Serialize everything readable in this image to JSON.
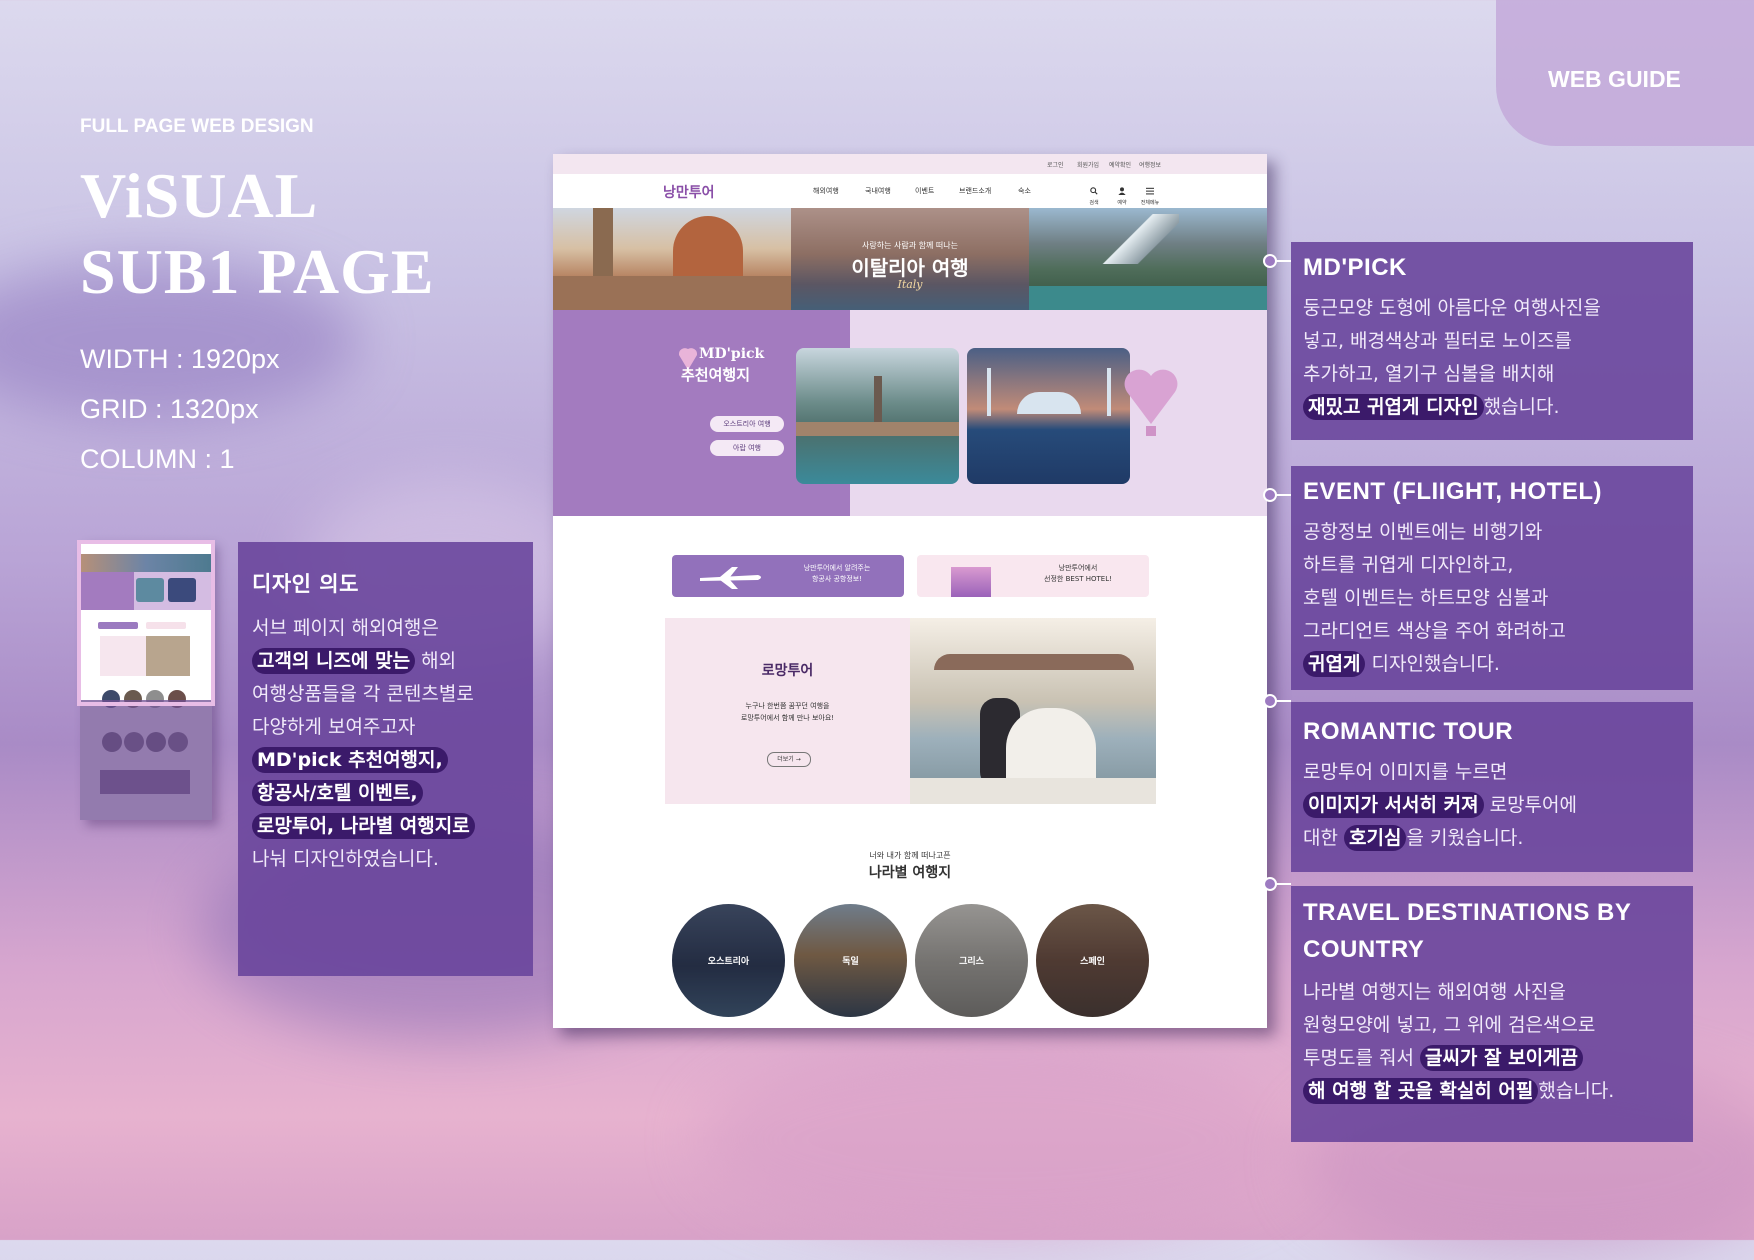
{
  "header": {
    "kicker": "FULL PAGE WEB DESIGN",
    "title_line1": "ViSUAL",
    "title_line2": "SUB1 PAGE",
    "width": "WIDTH : 1920px",
    "grid": "GRID : 1320px",
    "column": "COLUMN : 1",
    "guide_tab": "WEB GUIDE"
  },
  "intent_panel": {
    "title": "디자인 의도",
    "t1": "서브 페이지 해외여행은",
    "h1": "고객의 니즈에 맞는",
    "t2": " 해외",
    "t3": "여행상품들을 각 콘텐츠별로",
    "t4": "다양하게 보여주고자",
    "h2": "MD'pick 추천여행지,",
    "h3": "항공사/호텔 이벤트,",
    "h4": "로망투어, 나라별 여행지로",
    "t5": "나눠 디자인하였습니다."
  },
  "panels": {
    "mdpick": {
      "title": "MD'PICK",
      "l1": "둥근모양 도형에 아름다운 여행사진을",
      "l2": "넣고, 배경색상과 필터로 노이즈를",
      "l3": "추가하고, 열기구 심볼을 배치해",
      "hl": "재밌고 귀엽게 디자인",
      "l4": "했습니다."
    },
    "event": {
      "title": "EVENT (FLIIGHT, HOTEL)",
      "l1": "공항정보 이벤트에는 비행기와",
      "l2": "하트를 귀엽게 디자인하고,",
      "l3": "호텔 이벤트는 하트모양 심볼과",
      "l4": "그라디언트 색상을 주어 화려하고",
      "hl": "귀엽게",
      "l5": " 디자인했습니다."
    },
    "romantic": {
      "title": "ROMANTIC TOUR",
      "l1": "로망투어 이미지를 누르면",
      "hl1": "이미지가 서서히 커져",
      "l2": " 로망투어에",
      "l3": "대한 ",
      "hl2": "호기심",
      "l4": "을 키웠습니다."
    },
    "countries": {
      "title1": "TRAVEL DESTINATIONS BY",
      "title2": "COUNTRY",
      "l1": "나라별 여행지는 해외여행 사진을",
      "l2": "원형모양에 넣고, 그 위에 검은색으로",
      "l3": "투명도를 줘서 ",
      "hl1": "글씨가 잘 보이게끔",
      "hl2": "해 여행 할 곳을 확실히 어필",
      "l4": "했습니다."
    }
  },
  "mockup": {
    "util_links": [
      "로그인",
      "회원가입",
      "예약확인",
      "여행정보"
    ],
    "logo": "낭만투어",
    "menu": [
      "해외여행",
      "국내여행",
      "이벤트",
      "브랜드소개",
      "숙소"
    ],
    "icon_labels": [
      "검색",
      "예약",
      "전체메뉴"
    ],
    "hero_sub": "사랑하는 사람과 함께 떠나는",
    "hero_title": "이탈리아 여행",
    "hero_script": "Italy",
    "md_title": "MD'pick",
    "md_sub": "추천여행지",
    "md_btn1": "오스트리아 여행",
    "md_btn2": "아랍 여행",
    "event1_l1": "낭만투어에서 알려주는",
    "event1_l2": "항공사 공항정보!",
    "event2_l1": "낭만투어에서",
    "event2_l2": "선정한 BEST HOTEL!",
    "romantic_title": "로망투어",
    "romantic_l1": "누구나 한번쯤 꿈꾸던 여행을",
    "romantic_l2": "로망투어에서 함께 만나 보아요!",
    "romantic_btn": "더보기",
    "country_kicker": "너와 내가 함께 떠나고픈",
    "country_title": "나라별 여행지",
    "countries": [
      "오스트리아",
      "독일",
      "그리스",
      "스페인"
    ]
  },
  "colors": {
    "accent": "#68439b",
    "highlight": "#3b1a6a",
    "mdpick_bg": "#a37bbf"
  }
}
